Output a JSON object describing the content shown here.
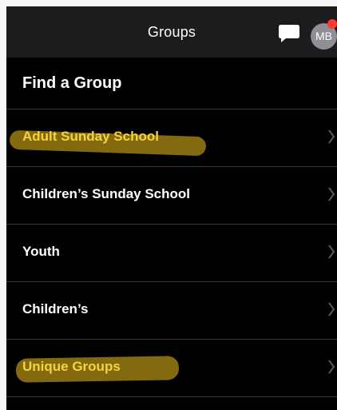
{
  "nav": {
    "title": "Groups",
    "avatar_initials": "MB",
    "chat_icon": "message-bubble-icon",
    "notification_color": "#ff3b30"
  },
  "section": {
    "title": "Find a Group"
  },
  "groups": [
    {
      "label": "Adult Sunday School",
      "highlighted": true
    },
    {
      "label": "Children’s Sunday School",
      "highlighted": false
    },
    {
      "label": "Youth",
      "highlighted": false
    },
    {
      "label": "Children’s",
      "highlighted": false
    },
    {
      "label": "Unique Groups",
      "highlighted": true
    }
  ],
  "colors": {
    "background": "#000000",
    "nav_background": "#1c1c1e",
    "highlight_text": "#f5d33d",
    "highlight_marker": "#9a7d12"
  }
}
